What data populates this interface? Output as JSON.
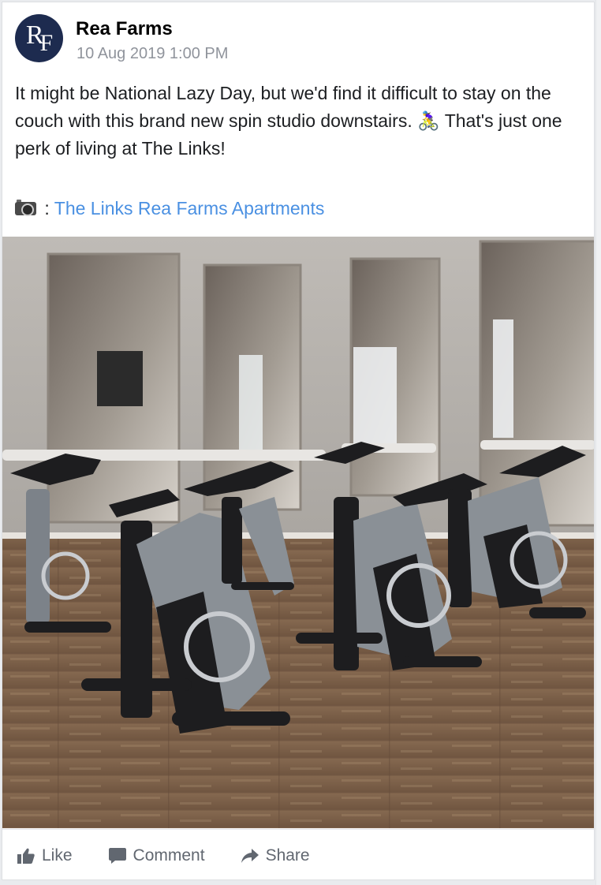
{
  "post": {
    "page_name": "Rea Farms",
    "avatar_initials": "RF",
    "avatar_bg": "#1d2b4f",
    "timestamp": "10 Aug 2019 1:00 PM",
    "text_line1": "It might be National Lazy Day, but we'd find it difficult to stay on the couch with this brand new spin studio downstairs. 🚴‍♀️ That's just one perk of living at The Links!",
    "credit_separator": ":",
    "credit_link": "The Links Rea Farms Apartments",
    "link_color": "#4a90e2",
    "photo_subject": "spin studio with exercise bikes, mirrors and wood floor"
  },
  "actions": {
    "like_label": "Like",
    "comment_label": "Comment",
    "share_label": "Share"
  },
  "icons": {
    "camera": "camera-icon",
    "like": "thumbs-up-icon",
    "comment": "comment-bubble-icon",
    "share": "share-arrow-icon"
  }
}
